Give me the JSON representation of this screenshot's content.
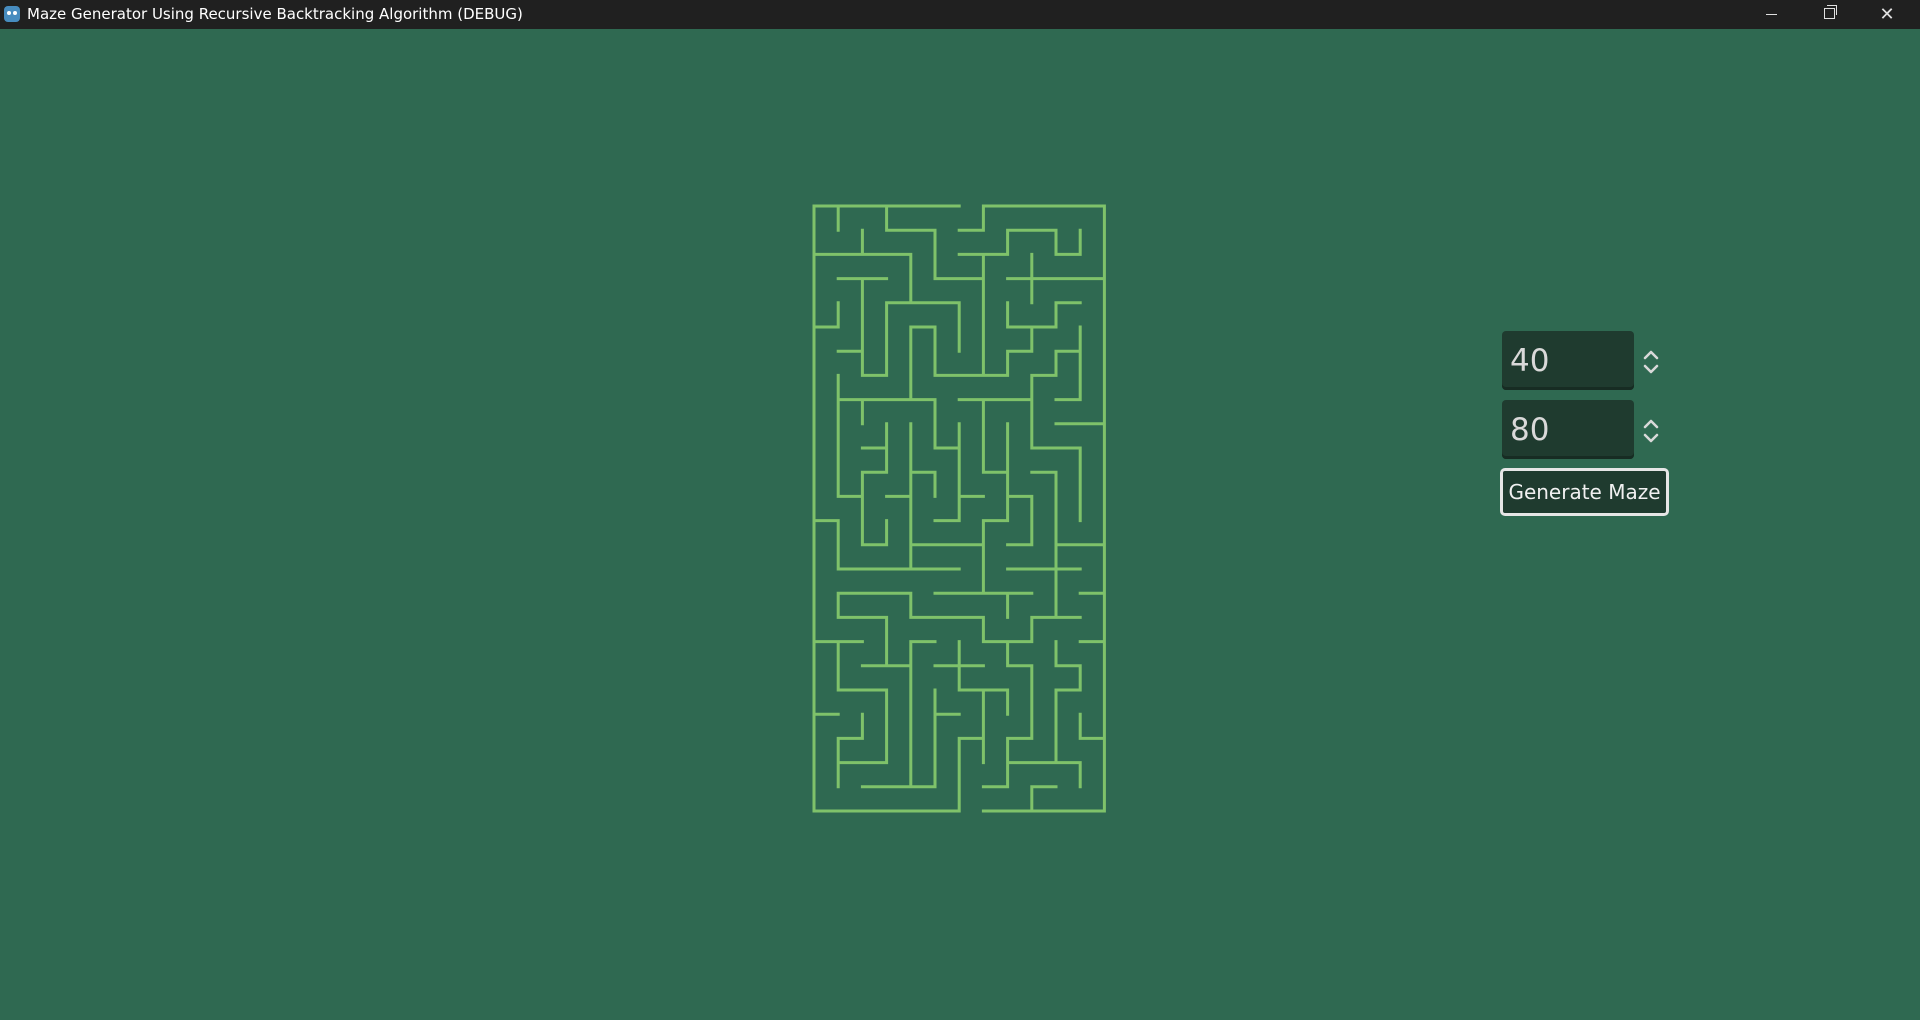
{
  "window": {
    "title": "Maze Generator Using Recursive Backtracking Algorithm (DEBUG)",
    "app_icon": "godot-icon",
    "controls": [
      "minimize-icon",
      "maximize-icon",
      "close-icon"
    ]
  },
  "colors": {
    "background": "#2f6951",
    "maze_wall": "#7fc26a",
    "titlebar": "#202020"
  },
  "maze": {
    "algorithm": "Recursive Backtracking",
    "cols": 12,
    "rows": 25
  },
  "controls": {
    "width_value": "40",
    "height_value": "80",
    "generate_label": "Generate Maze"
  }
}
